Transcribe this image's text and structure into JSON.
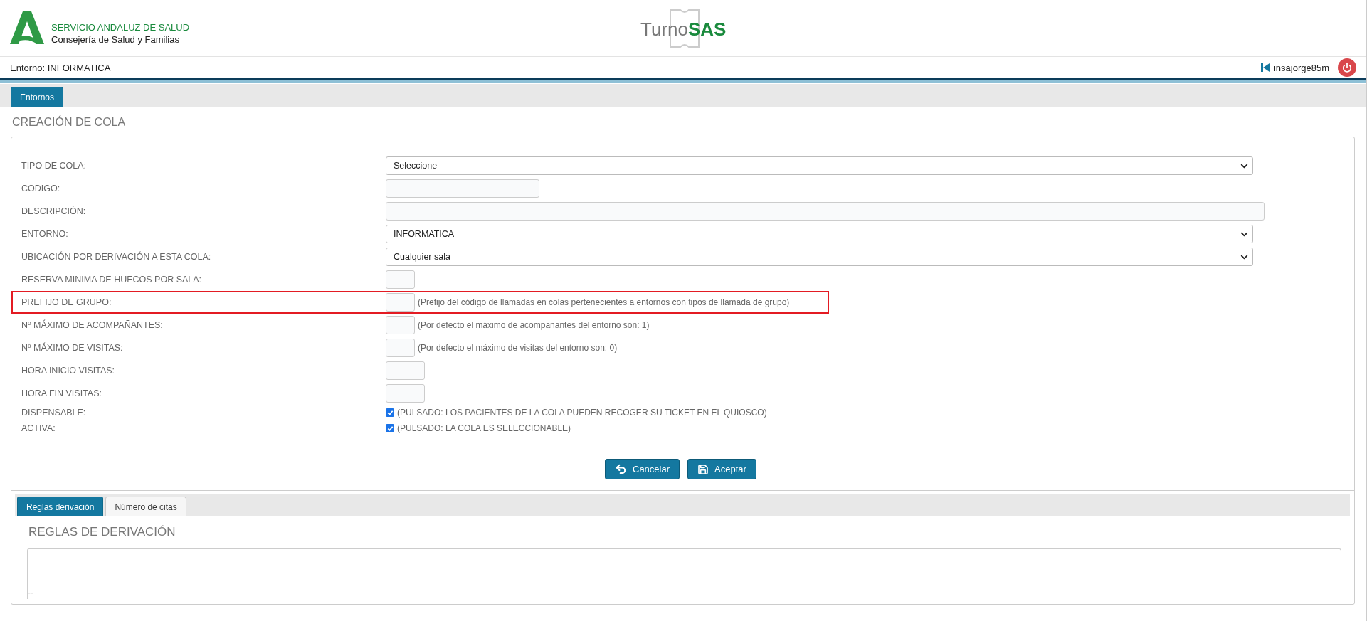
{
  "header": {
    "org_line1": "SERVICIO ANDALUZ DE SALUD",
    "org_line2": "Consejería de Salud y Familias",
    "app_name_light": "Turno",
    "app_name_bold": "SAS"
  },
  "env_bar": {
    "environment": "Entorno: INFORMATICA",
    "user": "insajorge85m"
  },
  "top_tabs": [
    {
      "label": "Entornos",
      "selected": true
    }
  ],
  "form": {
    "title": "CREACIÓN DE COLA",
    "fields": [
      {
        "label": "TIPO DE COLA:",
        "kind": "select",
        "value": "Seleccione"
      },
      {
        "label": "CODIGO:",
        "kind": "code"
      },
      {
        "label": "DESCRIPCIÓN:",
        "kind": "wide"
      },
      {
        "label": "ENTORNO:",
        "kind": "select",
        "value": "INFORMATICA"
      },
      {
        "label": "UBICACIÓN POR DERIVACIÓN A ESTA COLA:",
        "kind": "select",
        "value": "Cualquier sala"
      },
      {
        "label": "RESERVA MINIMA DE HUECOS POR SALA:",
        "kind": "number"
      },
      {
        "label": "PREFIJO DE GRUPO:",
        "kind": "number",
        "highlighted": true,
        "hint": "(Prefijo del código de llamadas en colas pertenecientes a entornos con tipos de llamada de grupo)"
      },
      {
        "label": "Nº MÁXIMO DE ACOMPAÑANTES:",
        "kind": "number",
        "hint": "(Por defecto el máximo de acompañantes del entorno son: 1)"
      },
      {
        "label": "Nº MÁXIMO DE VISITAS:",
        "kind": "number",
        "hint": "(Por defecto el máximo de visitas del entorno son: 0)"
      },
      {
        "label": "HORA INICIO VISITAS:",
        "kind": "time"
      },
      {
        "label": "HORA FIN VISITAS:",
        "kind": "time"
      },
      {
        "label": "DISPENSABLE:",
        "kind": "checkbox",
        "checked": true,
        "hint": "(PULSADO: LOS PACIENTES DE LA COLA PUEDEN RECOGER SU TICKET EN EL QUIOSCO)"
      },
      {
        "label": "ACTIVA:",
        "kind": "checkbox",
        "checked": true,
        "hint": "(PULSADO: LA COLA ES SELECCIONABLE)"
      }
    ]
  },
  "buttons": [
    {
      "label": "Cancelar",
      "kind": "cancel"
    },
    {
      "label": "Aceptar",
      "kind": "accept"
    }
  ],
  "bottom_tabs": [
    {
      "label": "Reglas derivación",
      "selected": true
    },
    {
      "label": "Número de citas",
      "selected": false
    }
  ],
  "rules": {
    "title": "REGLAS DE DERIVACIÓN",
    "content": "--"
  }
}
